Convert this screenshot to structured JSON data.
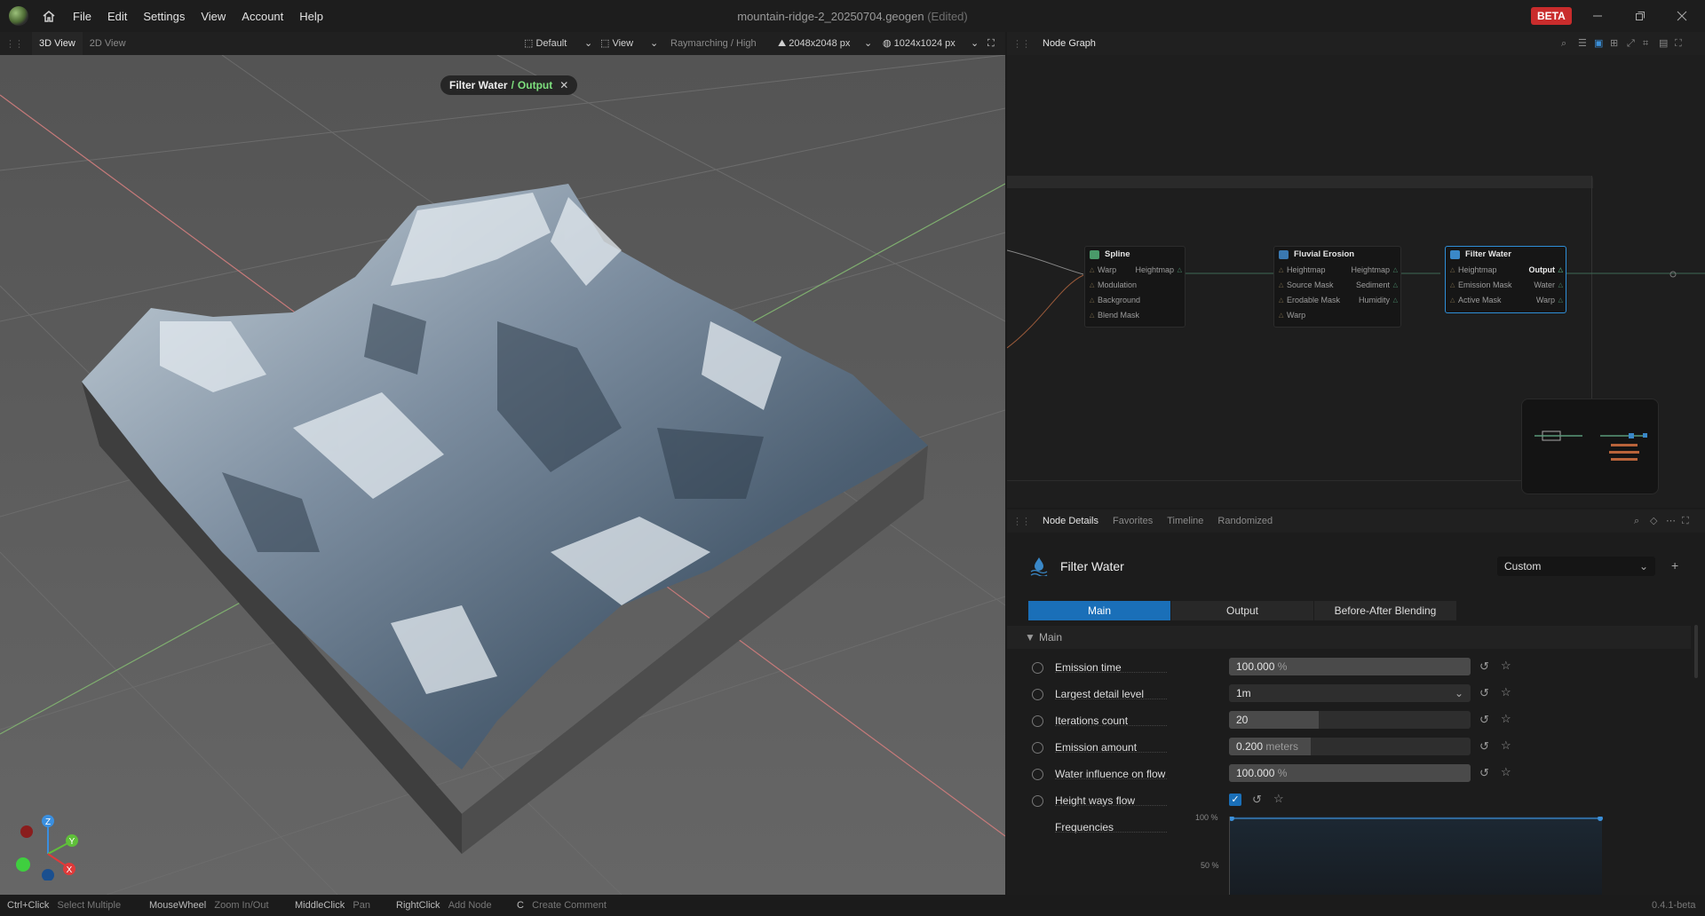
{
  "window": {
    "file_title": "mountain-ridge-2_20250704.geogen",
    "edited": "(Edited)",
    "beta": "BETA"
  },
  "menu": [
    "File",
    "Edit",
    "Settings",
    "View",
    "Account",
    "Help"
  ],
  "viewport_header": {
    "tabs": [
      "3D View",
      "2D View"
    ],
    "preset": "Default",
    "view": "View",
    "render_mode": "Raymarching / High",
    "resolution": "2048x2048 px",
    "preview_resolution": "1024x1024 px"
  },
  "breadcrumb": {
    "node": "Filter Water",
    "sep": "/",
    "output": "Output",
    "close": "✕"
  },
  "axes": {
    "z": "Z",
    "y": "Y",
    "x": "X"
  },
  "graph_header": {
    "title": "Node Graph"
  },
  "nodes": [
    {
      "title": "Spline",
      "inputs": [
        "Warp",
        "Modulation",
        "Background",
        "Blend Mask"
      ],
      "outputs": [
        "Heightmap"
      ]
    },
    {
      "title": "Fluvial Erosion",
      "inputs": [
        "Heightmap",
        "Source Mask",
        "Erodable Mask",
        "Warp"
      ],
      "outputs": [
        "Heightmap",
        "Sediment",
        "Humidity"
      ]
    },
    {
      "title": "Filter Water",
      "inputs": [
        "Heightmap",
        "Emission Mask",
        "Active Mask"
      ],
      "outputs": [
        "Output",
        "Water",
        "Warp"
      ]
    }
  ],
  "details_header": {
    "tabs": [
      "Node Details",
      "Favorites",
      "Timeline",
      "Randomized"
    ]
  },
  "details": {
    "node_name": "Filter Water",
    "preset": "Custom",
    "tabs": [
      "Main",
      "Output",
      "Before-After Blending"
    ],
    "section": "Main",
    "props": [
      {
        "label": "Emission time",
        "value": "100.000",
        "unit": "%",
        "fill": 1.0
      },
      {
        "label": "Largest detail level",
        "value": "1m",
        "unit": "",
        "fill": 0
      },
      {
        "label": "Iterations count",
        "value": "20",
        "unit": "",
        "fill": 0.37
      },
      {
        "label": "Emission amount",
        "value": "0.200",
        "unit": "meters",
        "fill": 0.34
      },
      {
        "label": "Water influence on flow",
        "value": "100.000",
        "unit": "%",
        "fill": 1.0
      },
      {
        "label": "Height ways flow",
        "value": "",
        "unit": "",
        "fill": 0
      },
      {
        "label": "Frequencies",
        "value": "",
        "unit": "",
        "fill": 0
      }
    ],
    "curve_labels": {
      "top": "100 %",
      "mid": "50 %"
    }
  },
  "status": [
    {
      "key": "Ctrl+Click",
      "action": "Select Multiple"
    },
    {
      "key": "MouseWheel",
      "action": "Zoom In/Out"
    },
    {
      "key": "MiddleClick",
      "action": "Pan"
    },
    {
      "key": "RightClick",
      "action": "Add Node"
    },
    {
      "key": "C",
      "action": "Create Comment"
    }
  ],
  "version": "0.4.1-beta",
  "colors": {
    "accent": "#1a6fb8",
    "beta": "#c92c2c",
    "output_green": "#7ee07e"
  }
}
